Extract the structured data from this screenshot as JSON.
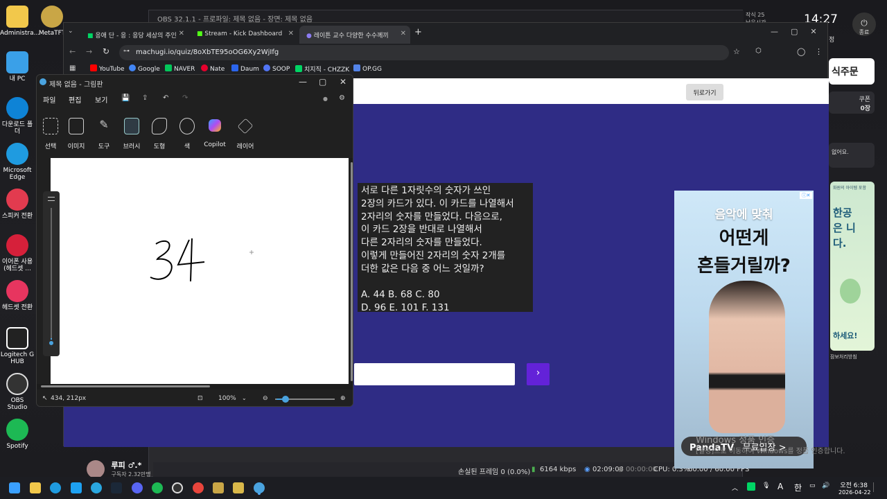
{
  "desktop": {
    "icons": [
      "Administra...",
      "MetaTFT",
      "내 PC",
      "다운로드 폴더",
      "Microsoft Edge",
      "스피커 전환",
      "이어폰 사용 (헤드셋 ...",
      "헤드셋 전환",
      "Logitech G HUB",
      "OBS Studio",
      "Spotify"
    ]
  },
  "obs": {
    "title": "OBS 32.1.1 - 프로파일: 제목 없음 - 장면: 제목 없음",
    "status": {
      "dropped": "손실된 프레임 0 (0.0%)",
      "bitrate": "6164 kbps",
      "stream_time": "02:09:08",
      "rec_time": "00:00:00",
      "cpu": "CPU: 0.3%",
      "fps": "60.00 / 60.00 FPS"
    },
    "chat_name": "루피 ♂.*",
    "chat_sub": "구독자 2.32만명"
  },
  "right_panel": {
    "clock": "14:27",
    "date_small": "작식 25",
    "date_small2": "남은시간",
    "power_label": "종료",
    "order": "식주문",
    "coupon_label": "쿠폰",
    "coupon_value": "0장",
    "note": "없어요.",
    "promo_text": "한공은 니다.",
    "promo_top": "화원의 아이템 포함",
    "promo_bottom": "하세요!",
    "promo_foot": "잠보처리방침",
    "settings_small": "정"
  },
  "chrome": {
    "tabs": [
      {
        "label": "응애 단 - 응 : 응당 세상의 주인"
      },
      {
        "label": "Stream - Kick Dashboard"
      },
      {
        "label": "레이튼 교수 다양한 수수께끼"
      }
    ],
    "new_tab": "+",
    "url": "machugi.io/quiz/8oXbTE95oOG6Xy2WjIfg",
    "bookmarks": [
      "YouTube",
      "Google",
      "NAVER",
      "Nate",
      "Daum",
      "SOOP",
      "치지직 - CHZZK",
      "OP.GG"
    ],
    "bookmark_colors": [
      "#ff0000",
      "#4285f4",
      "#03c75a",
      "#e6002d",
      "#2b65ec",
      "#5275f5",
      "#00d564",
      "#5383e8"
    ]
  },
  "quiz": {
    "back_button": "뒤로가기",
    "question": "서로 다른 1자릿수의 숫자가 쓰인\n2장의 카드가 있다. 이 카드를 나열해서\n2자리의 숫자를 만들었다. 다음으로,\n이 카드 2장을 반대로 나열해서\n다른 2자리의 숫자를 만들었다.\n이렇게 만들어진 2자리의 숫자 2개를\n더한 값은 다음 중 어느 것일까?\n\nA. 44 B. 68 C. 80\nD. 96 E. 101 F. 131",
    "submit_icon": "›",
    "scroll_up_icon": "︿"
  },
  "ad": {
    "line1": "음악에 맞춰",
    "line2": "어떤게",
    "line3": "흔들거릴까?",
    "brand": "PandaTV",
    "cta": "무료입장 >"
  },
  "paint": {
    "title": "제목 없음 - 그림판",
    "menu": [
      "파일",
      "편집",
      "보기"
    ],
    "tools": [
      "선택",
      "이미지",
      "도구",
      "브러시",
      "도형",
      "색",
      "Copilot",
      "레이어"
    ],
    "drawing_text": "34",
    "coords": "434, 212px",
    "zoom": "100%"
  },
  "watermark": {
    "line1": "Windows 정품 인증",
    "line2": "[설정]으로 이동하여 Windows를 정품 인증합니다."
  },
  "taskbar": {
    "time": "오전 6:38",
    "date": "2026-04-22",
    "lang": "A",
    "ime": "한"
  }
}
